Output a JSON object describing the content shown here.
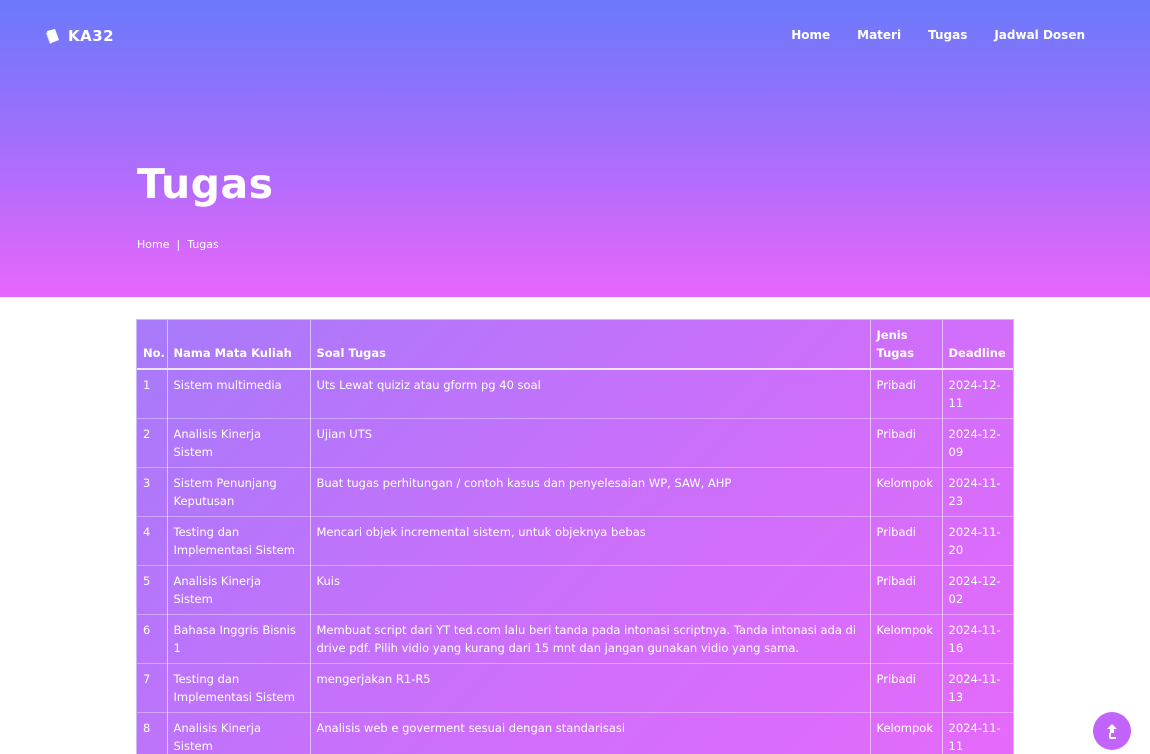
{
  "brand": {
    "name": "KA32"
  },
  "nav": {
    "items": [
      {
        "label": "Home"
      },
      {
        "label": "Materi"
      },
      {
        "label": "Tugas"
      },
      {
        "label": "Jadwal Dosen"
      }
    ]
  },
  "hero": {
    "title": "Tugas",
    "breadcrumb": {
      "home": "Home",
      "separator": "|",
      "current": "Tugas"
    }
  },
  "table": {
    "headers": [
      "No.",
      "Nama Mata Kuliah",
      "Soal Tugas",
      "Jenis Tugas",
      "Deadline"
    ],
    "rows": [
      [
        "1",
        "Sistem multimedia",
        "Uts Lewat quiziz atau gform pg 40 soal",
        "Pribadi",
        "2024-12-11"
      ],
      [
        "2",
        "Analisis Kinerja Sistem",
        "Ujian UTS",
        "Pribadi",
        "2024-12-09"
      ],
      [
        "3",
        "Sistem Penunjang Keputusan",
        "Buat tugas perhitungan / contoh kasus dan penyelesaian WP, SAW, AHP",
        "Kelompok",
        "2024-11-23"
      ],
      [
        "4",
        "Testing dan Implementasi Sistem",
        "Mencari objek incremental sistem, untuk objeknya bebas",
        "Pribadi",
        "2024-11-20"
      ],
      [
        "5",
        "Analisis Kinerja Sistem",
        "Kuis",
        "Pribadi",
        "2024-12-02"
      ],
      [
        "6",
        "Bahasa Inggris Bisnis 1",
        "Membuat script dari YT ted.com lalu beri tanda pada intonasi scriptnya. Tanda intonasi ada di drive pdf. Pilih vidio yang kurang dari 15 mnt dan jangan gunakan vidio yang sama.",
        "Kelompok",
        "2024-11-16"
      ],
      [
        "7",
        "Testing dan Implementasi Sistem",
        "mengerjakan R1-R5",
        "Pribadi",
        "2024-11-13"
      ],
      [
        "8",
        "Analisis Kinerja Sistem",
        "Analisis web e goverment sesuai dengan standarisasi",
        "Kelompok",
        "2024-11-11"
      ]
    ]
  },
  "icons": {
    "brand": "book-icon",
    "scroll_top": "arrow-up-icon"
  },
  "colors": {
    "hero_top": "#6b79fb",
    "hero_bottom": "#e866fb",
    "scroll_button": "#c264fb"
  }
}
